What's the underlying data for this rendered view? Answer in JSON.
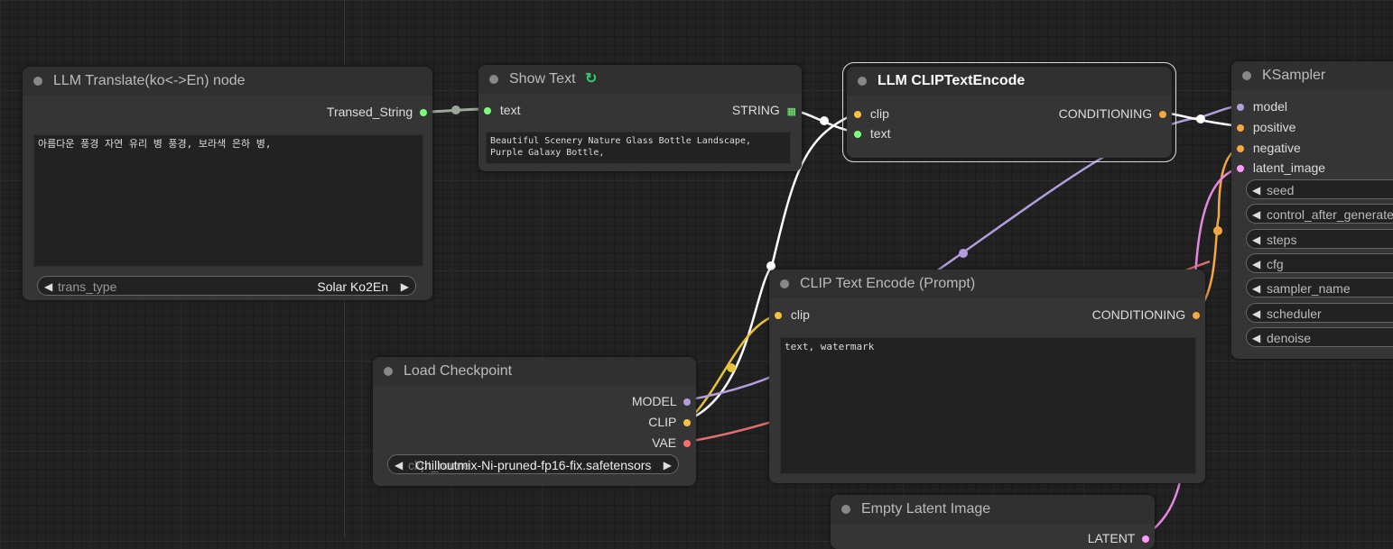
{
  "colors": {
    "clip": "#f5c242",
    "model": "#b39ddb",
    "conditioning": "#f5a742",
    "vae": "#ff6e6e",
    "latent": "#ff9cf9",
    "string": "#7cff7c",
    "selection": "#dddddd"
  },
  "nodes": {
    "translate": {
      "title": "LLM Translate(ko<->En) node",
      "output_label": "Transed_String",
      "text_value": "아름다운 풍경 자연 유리 병 풍경, 보라색 은하 병,",
      "combo_label": "trans_type",
      "combo_value": "Solar Ko2En"
    },
    "show_text": {
      "title": "Show Text",
      "title_icon": "link-icon",
      "input_label": "text",
      "output_label": "STRING",
      "output_icon": "grid-icon",
      "text_value": "Beautiful Scenery Nature Glass Bottle Landscape,\nPurple Galaxy Bottle,"
    },
    "clip_encode_llm": {
      "title": "LLM CLIPTextEncode",
      "input_clip": "clip",
      "input_text": "text",
      "output_label": "CONDITIONING"
    },
    "ksampler": {
      "title": "KSampler",
      "inputs": [
        "model",
        "positive",
        "negative",
        "latent_image"
      ],
      "widgets": [
        "seed",
        "control_after_generate",
        "steps",
        "cfg",
        "sampler_name",
        "scheduler",
        "denoise"
      ]
    },
    "clip_encode_prompt": {
      "title": "CLIP Text Encode (Prompt)",
      "input_clip": "clip",
      "output_label": "CONDITIONING",
      "text_value": "text, watermark"
    },
    "load_checkpoint": {
      "title": "Load Checkpoint",
      "outputs": [
        "MODEL",
        "CLIP",
        "VAE"
      ],
      "combo_label": "ckpt_name",
      "combo_value": "Chilloutmix-Ni-pruned-fp16-fix.safetensors"
    },
    "empty_latent": {
      "title": "Empty Latent Image",
      "output_label": "LATENT"
    }
  }
}
